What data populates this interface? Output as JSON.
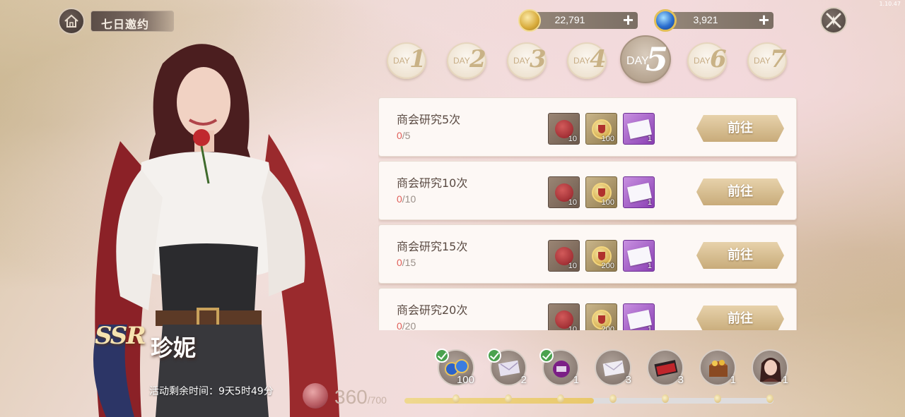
{
  "version": "1.10.47",
  "header": {
    "title": "七日邀约"
  },
  "currencies": [
    {
      "name": "gold",
      "amount": "22,791",
      "plus": "+"
    },
    {
      "name": "gem",
      "amount": "3,921",
      "plus": "+"
    }
  ],
  "days": [
    {
      "word": "DAY",
      "num": "1",
      "active": false
    },
    {
      "word": "DAY",
      "num": "2",
      "active": false
    },
    {
      "word": "DAY",
      "num": "3",
      "active": false
    },
    {
      "word": "DAY",
      "num": "4",
      "active": false
    },
    {
      "word": "DAY",
      "num": "5",
      "active": true
    },
    {
      "word": "DAY",
      "num": "6",
      "active": false
    },
    {
      "word": "DAY",
      "num": "7",
      "active": false
    }
  ],
  "character": {
    "rarity": "SSR",
    "name": "珍妮"
  },
  "timer": "活动剩余时间：9天5时49分",
  "tasks": [
    {
      "name": "商会研究5次",
      "current": "0",
      "target": "/5",
      "rewards": [
        {
          "type": "seal",
          "qty": "10"
        },
        {
          "type": "coin",
          "qty": "100"
        },
        {
          "type": "letter",
          "qty": "1"
        }
      ],
      "button": "前往"
    },
    {
      "name": "商会研究10次",
      "current": "0",
      "target": "/10",
      "rewards": [
        {
          "type": "seal",
          "qty": "10"
        },
        {
          "type": "coin",
          "qty": "100"
        },
        {
          "type": "letter",
          "qty": "1"
        }
      ],
      "button": "前往"
    },
    {
      "name": "商会研究15次",
      "current": "0",
      "target": "/15",
      "rewards": [
        {
          "type": "seal",
          "qty": "10"
        },
        {
          "type": "coin",
          "qty": "200"
        },
        {
          "type": "letter",
          "qty": "1"
        }
      ],
      "button": "前往"
    },
    {
      "name": "商会研究20次",
      "current": "0",
      "target": "/20",
      "rewards": [
        {
          "type": "seal",
          "qty": "10"
        },
        {
          "type": "coin",
          "qty": "200"
        },
        {
          "type": "letter",
          "qty": "1"
        }
      ],
      "button": "前往"
    }
  ],
  "progress": {
    "points": "360",
    "max": "/700",
    "fraction": 0.514
  },
  "milestones": [
    {
      "item": "gems",
      "qty": "100",
      "claimed": true
    },
    {
      "item": "letter",
      "qty": "2",
      "claimed": true
    },
    {
      "item": "pouch",
      "qty": "1",
      "claimed": true
    },
    {
      "item": "letter",
      "qty": "3",
      "claimed": false
    },
    {
      "item": "red-envelope",
      "qty": "3",
      "claimed": false
    },
    {
      "item": "treasure-chest",
      "qty": "1",
      "claimed": false
    },
    {
      "item": "character-portrait",
      "qty": "1",
      "claimed": false
    }
  ],
  "colors": {
    "accent_gold": "#c8ab7a",
    "progress_current": "#e0605a",
    "claimed_check": "#4aa24e"
  }
}
